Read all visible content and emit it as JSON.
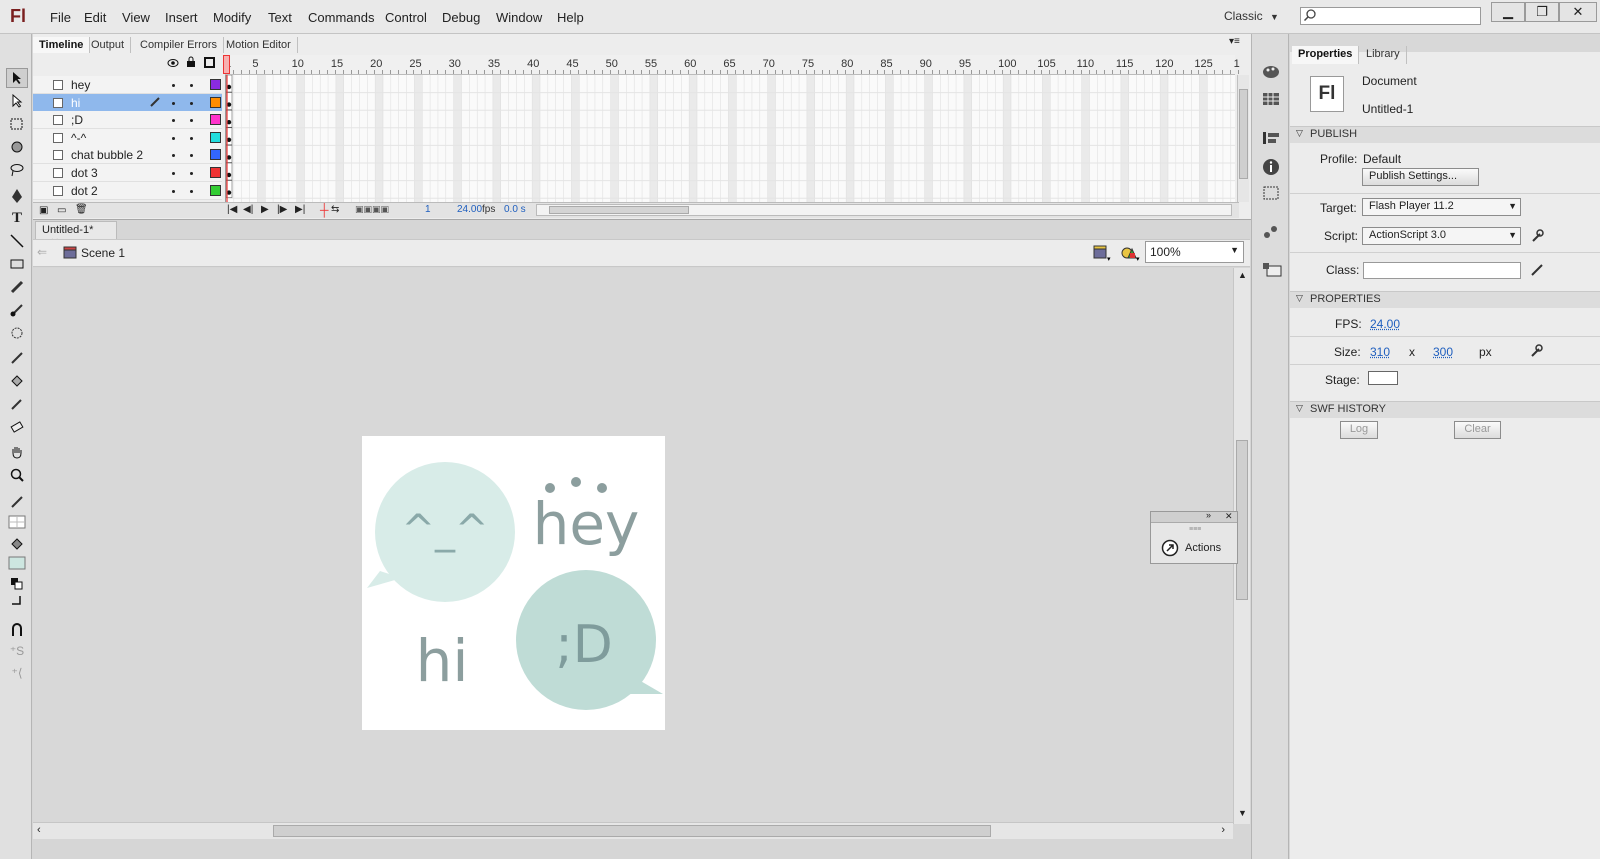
{
  "app": {
    "logo": "Fl"
  },
  "menu": [
    "File",
    "Edit",
    "View",
    "Insert",
    "Modify",
    "Text",
    "Commands",
    "Control",
    "Debug",
    "Window",
    "Help"
  ],
  "workspace": "Classic",
  "search": {
    "placeholder": ""
  },
  "timeline_tabs": [
    "Timeline",
    "Output",
    "Compiler Errors",
    "Motion Editor"
  ],
  "layers": [
    {
      "name": "hey",
      "color": "#8a2be2"
    },
    {
      "name": "hi",
      "color": "#ff8c00",
      "selected": true
    },
    {
      "name": ";D",
      "color": "#ff33cc"
    },
    {
      "name": "^-^",
      "color": "#22dddd"
    },
    {
      "name": "chat bubble 2",
      "color": "#3366ff"
    },
    {
      "name": "dot 3",
      "color": "#ee3333"
    },
    {
      "name": "dot 2",
      "color": "#33cc33"
    }
  ],
  "ruler": [
    "1",
    "5",
    "10",
    "15",
    "20",
    "25",
    "30",
    "35",
    "40",
    "45",
    "50",
    "55",
    "60",
    "65",
    "70",
    "75",
    "80",
    "85",
    "90",
    "95",
    "100",
    "105",
    "110",
    "115",
    "120",
    "125",
    "1"
  ],
  "timeline_status": {
    "frame": "1",
    "fps": "24.00",
    "fps_unit": "fps",
    "time": "0.0 s"
  },
  "document_tab": "Untitled-1*",
  "scene": "Scene 1",
  "zoom": "100%",
  "stage": {
    "bubble1_text": "^_^",
    "hey_text": "hey",
    "hi_text": "hi",
    "bubble2_text": ";D"
  },
  "actions_panel": {
    "label": "Actions"
  },
  "properties": {
    "tabs": [
      "Properties",
      "Library"
    ],
    "doc_type": "Document",
    "doc_name": "Untitled-1",
    "publish_header": "PUBLISH",
    "profile_label": "Profile:",
    "profile_value": "Default",
    "publish_settings_button": "Publish Settings...",
    "target_label": "Target:",
    "target_value": "Flash Player 11.2",
    "script_label": "Script:",
    "script_value": "ActionScript 3.0",
    "class_label": "Class:",
    "class_value": "",
    "properties_header": "PROPERTIES",
    "fps_label": "FPS:",
    "fps_value": "24.00",
    "size_label": "Size:",
    "width": "310",
    "size_x": "x",
    "height": "300",
    "size_unit": "px",
    "stage_label": "Stage:",
    "swf_header": "SWF HISTORY",
    "log_button": "Log",
    "clear_button": "Clear"
  }
}
